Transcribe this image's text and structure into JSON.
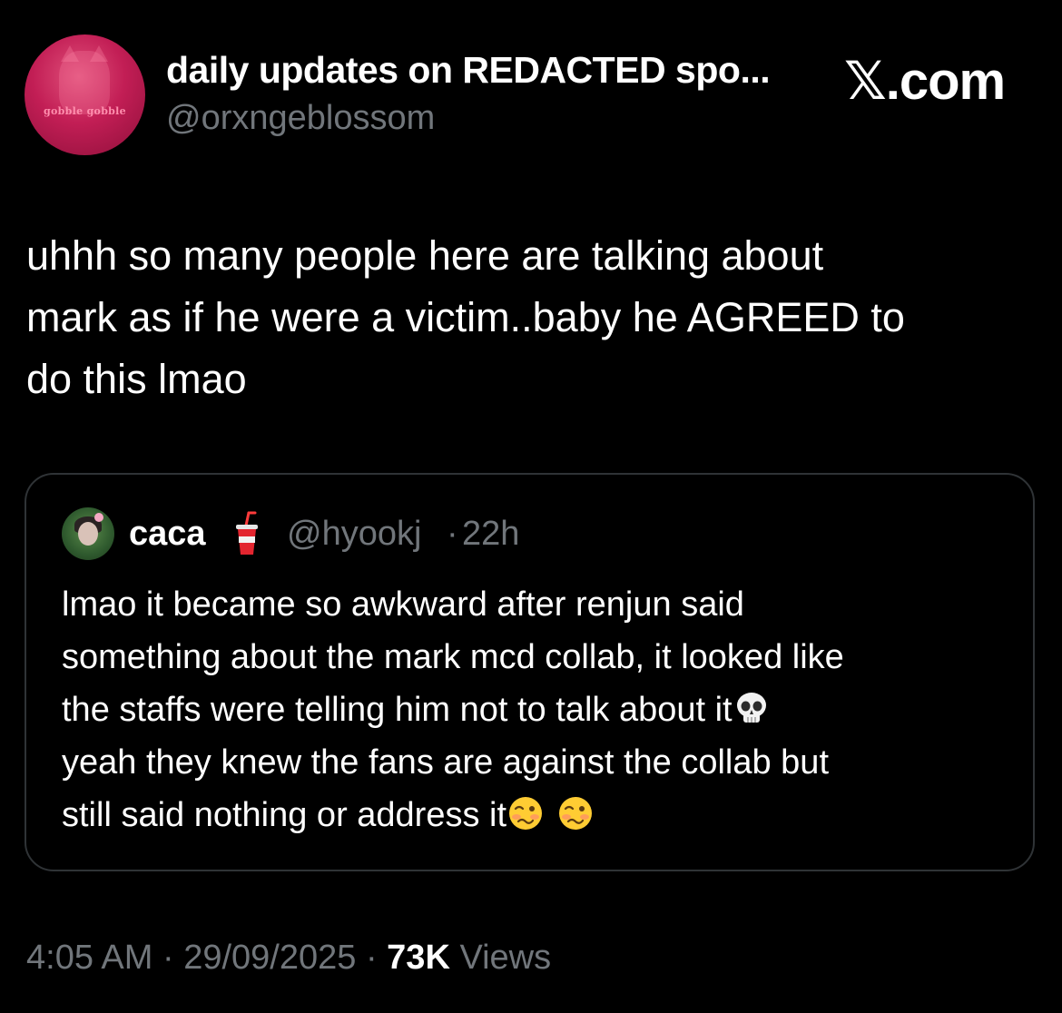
{
  "author": {
    "name": "daily updates on REDACTED spo...",
    "handle": "@orxngeblossom",
    "avatar_text": "gobble gobble"
  },
  "site_logo": {
    "mark": "𝕏",
    "suffix": ".com"
  },
  "tweet": {
    "text": "uhhh so many people here are talking about\nmark as if he were a victim..baby he AGREED to\ndo this lmao"
  },
  "quote": {
    "name": "caca",
    "name_emoji": "cup-with-straw-icon",
    "handle": "@hyookj",
    "separator": "·",
    "time": "22h",
    "line1": "lmao it became so awkward after renjun said",
    "line2": "something about the mark mcd collab, it looked like",
    "line3": "the staffs were telling him not to talk about it",
    "line3_emoji": "skull-icon",
    "line4": "yeah they knew the fans are against the collab but",
    "line5": "still said nothing or address it",
    "line5_emojis": [
      "woozy-face-icon",
      "woozy-face-icon"
    ]
  },
  "footer": {
    "time": "4:05 AM",
    "sep1": " · ",
    "date": "29/09/2025",
    "sep2": " · ",
    "views_count": "73K",
    "views_label": " Views"
  },
  "colors": {
    "background": "#000000",
    "text_primary": "#ffffff",
    "text_secondary": "#71767b",
    "border": "#2f3336",
    "avatar_accent": "#c21e55"
  }
}
